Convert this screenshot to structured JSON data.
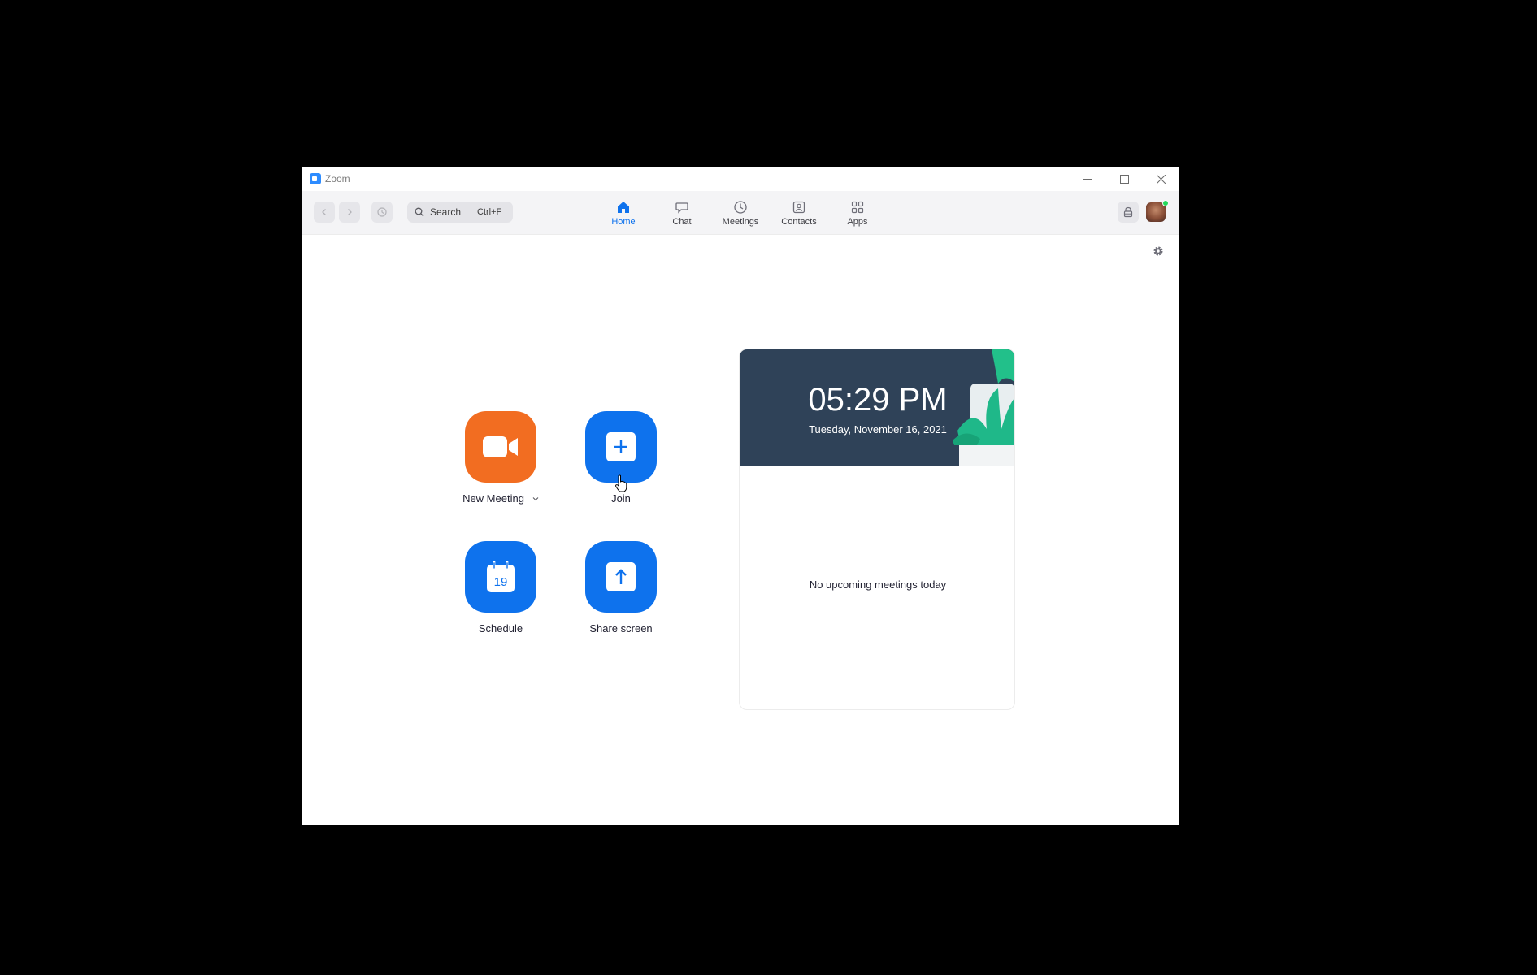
{
  "window": {
    "title": "Zoom"
  },
  "toolbar": {
    "search": {
      "label": "Search",
      "shortcut": "Ctrl+F"
    },
    "tabs": [
      {
        "label": "Home",
        "icon": "home-icon",
        "active": true
      },
      {
        "label": "Chat",
        "icon": "chat-icon",
        "active": false
      },
      {
        "label": "Meetings",
        "icon": "clock-icon",
        "active": false
      },
      {
        "label": "Contacts",
        "icon": "contacts-icon",
        "active": false
      },
      {
        "label": "Apps",
        "icon": "apps-icon",
        "active": false
      }
    ]
  },
  "actions": {
    "new_meeting": {
      "label": "New Meeting",
      "icon": "video-camera-icon"
    },
    "join": {
      "label": "Join",
      "icon": "plus-icon"
    },
    "schedule": {
      "label": "Schedule",
      "icon": "calendar-icon",
      "day": "19"
    },
    "share_screen": {
      "label": "Share screen",
      "icon": "arrow-up-icon"
    }
  },
  "calendar": {
    "time": "05:29 PM",
    "date": "Tuesday, November 16, 2021",
    "empty_message": "No upcoming meetings today"
  },
  "colors": {
    "accent_blue": "#0e72ed",
    "accent_orange": "#f26d21",
    "header_bg": "#2f4258",
    "presence_green": "#23d959"
  }
}
